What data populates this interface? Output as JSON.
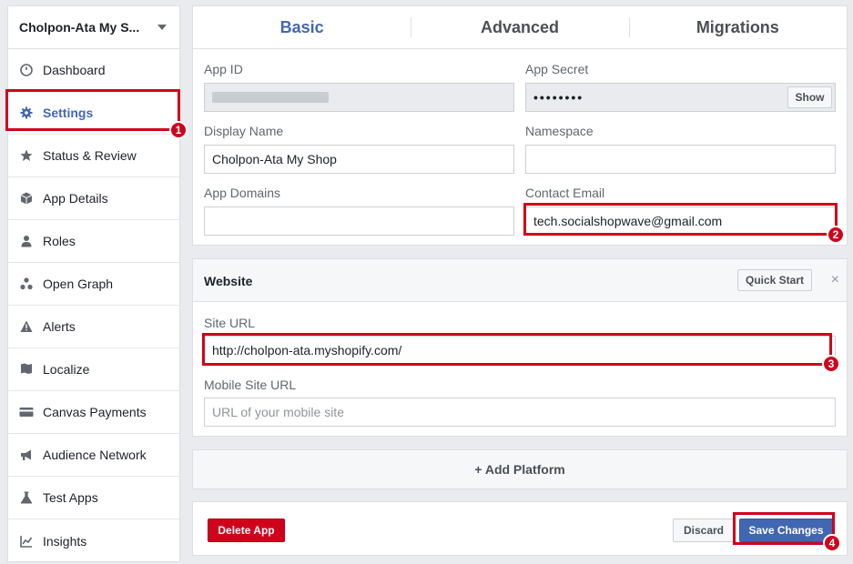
{
  "sidebar": {
    "app_name": "Cholpon-Ata My S...",
    "items": [
      {
        "label": "Dashboard",
        "icon": "dashboard-icon"
      },
      {
        "label": "Settings",
        "icon": "gear-icon"
      },
      {
        "label": "Status & Review",
        "icon": "star-icon"
      },
      {
        "label": "App Details",
        "icon": "cube-icon"
      },
      {
        "label": "Roles",
        "icon": "person-icon"
      },
      {
        "label": "Open Graph",
        "icon": "graph-icon"
      },
      {
        "label": "Alerts",
        "icon": "warning-icon"
      },
      {
        "label": "Localize",
        "icon": "flag-icon"
      },
      {
        "label": "Canvas Payments",
        "icon": "card-icon"
      },
      {
        "label": "Audience Network",
        "icon": "megaphone-icon"
      },
      {
        "label": "Test Apps",
        "icon": "flask-icon"
      },
      {
        "label": "Insights",
        "icon": "chart-icon"
      }
    ],
    "active_index": 1
  },
  "tabs": [
    "Basic",
    "Advanced",
    "Migrations"
  ],
  "basic": {
    "app_id_label": "App ID",
    "app_secret_label": "App Secret",
    "app_secret_value": "••••••••",
    "show_label": "Show",
    "display_name_label": "Display Name",
    "display_name_value": "Cholpon-Ata My Shop",
    "namespace_label": "Namespace",
    "namespace_value": "",
    "app_domains_label": "App Domains",
    "app_domains_value": "",
    "contact_email_label": "Contact Email",
    "contact_email_value": "tech.socialshopwave@gmail.com"
  },
  "website": {
    "title": "Website",
    "quick_start_label": "Quick Start",
    "close_glyph": "×",
    "site_url_label": "Site URL",
    "site_url_value": "http://cholpon-ata.myshopify.com/",
    "mobile_url_label": "Mobile Site URL",
    "mobile_url_placeholder": "URL of your mobile site"
  },
  "add_platform_label": "+ Add Platform",
  "footer": {
    "delete_label": "Delete App",
    "discard_label": "Discard",
    "save_label": "Save Changes"
  },
  "annotations": [
    "1",
    "2",
    "3",
    "4"
  ],
  "colors": {
    "accent": "#4267b2",
    "highlight": "#d0021b"
  }
}
